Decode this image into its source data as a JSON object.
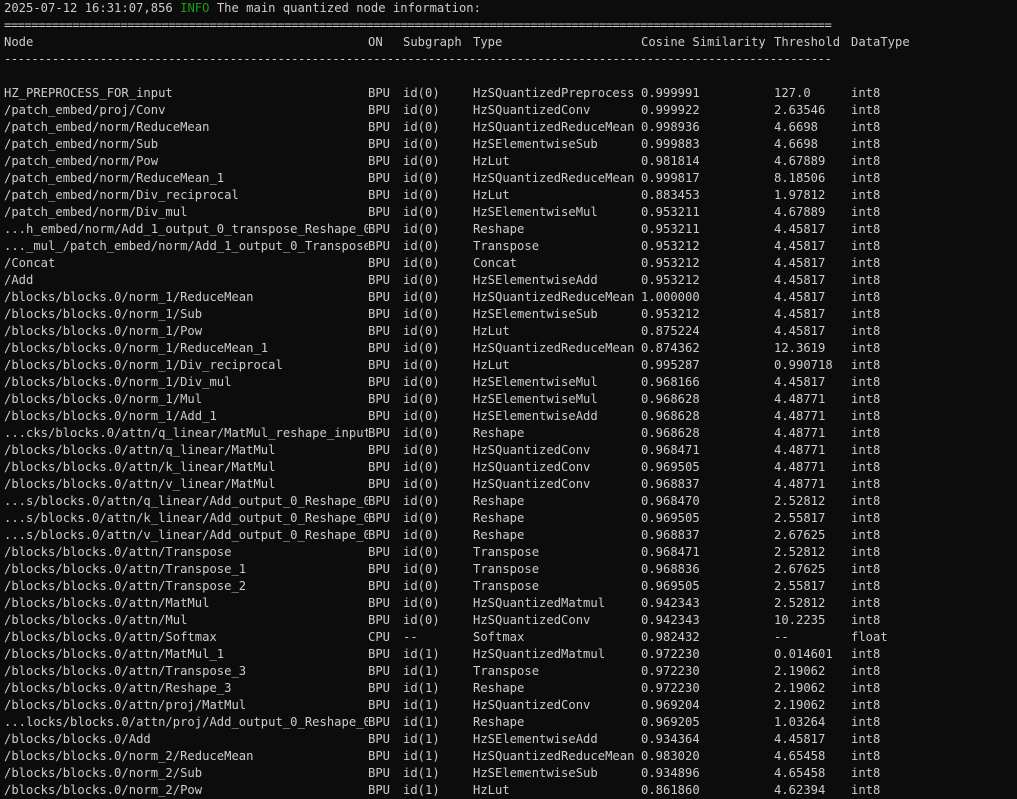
{
  "log": {
    "timestamp": "2025-07-12 16:31:07,856",
    "level": "INFO",
    "message": "The main quantized node information:"
  },
  "table": {
    "separator_double": "=========================================================================================================================",
    "separator_single": "-------------------------------------------------------------------------------------------------------------------------",
    "headers": {
      "node": "Node",
      "on": "ON",
      "subgraph": "Subgraph",
      "type": "Type",
      "cosine": "Cosine Similarity",
      "threshold": "Threshold",
      "datatype": "DataType"
    },
    "rows": [
      [
        "HZ_PREPROCESS_FOR_input",
        "BPU",
        "id(0)",
        "HzSQuantizedPreprocess",
        "0.999991",
        "127.0",
        "int8"
      ],
      [
        "/patch_embed/proj/Conv",
        "BPU",
        "id(0)",
        "HzSQuantizedConv",
        "0.999922",
        "2.63546",
        "int8"
      ],
      [
        "/patch_embed/norm/ReduceMean",
        "BPU",
        "id(0)",
        "HzSQuantizedReduceMean",
        "0.998936",
        "4.6698",
        "int8"
      ],
      [
        "/patch_embed/norm/Sub",
        "BPU",
        "id(0)",
        "HzSElementwiseSub",
        "0.999883",
        "4.6698",
        "int8"
      ],
      [
        "/patch_embed/norm/Pow",
        "BPU",
        "id(0)",
        "HzLut",
        "0.981814",
        "4.67889",
        "int8"
      ],
      [
        "/patch_embed/norm/ReduceMean_1",
        "BPU",
        "id(0)",
        "HzSQuantizedReduceMean",
        "0.999817",
        "8.18506",
        "int8"
      ],
      [
        "/patch_embed/norm/Div_reciprocal",
        "BPU",
        "id(0)",
        "HzLut",
        "0.883453",
        "1.97812",
        "int8"
      ],
      [
        "/patch_embed/norm/Div_mul",
        "BPU",
        "id(0)",
        "HzSElementwiseMul",
        "0.953211",
        "4.67889",
        "int8"
      ],
      [
        "...h_embed/norm/Add_1_output_0_transpose_Reshape_0",
        "BPU",
        "id(0)",
        "Reshape",
        "0.953211",
        "4.45817",
        "int8"
      ],
      [
        "..._mul_/patch_embed/norm/Add_1_output_0_Transpose",
        "BPU",
        "id(0)",
        "Transpose",
        "0.953212",
        "4.45817",
        "int8"
      ],
      [
        "/Concat",
        "BPU",
        "id(0)",
        "Concat",
        "0.953212",
        "4.45817",
        "int8"
      ],
      [
        "/Add",
        "BPU",
        "id(0)",
        "HzSElementwiseAdd",
        "0.953212",
        "4.45817",
        "int8"
      ],
      [
        "/blocks/blocks.0/norm_1/ReduceMean",
        "BPU",
        "id(0)",
        "HzSQuantizedReduceMean",
        "1.000000",
        "4.45817",
        "int8"
      ],
      [
        "/blocks/blocks.0/norm_1/Sub",
        "BPU",
        "id(0)",
        "HzSElementwiseSub",
        "0.953212",
        "4.45817",
        "int8"
      ],
      [
        "/blocks/blocks.0/norm_1/Pow",
        "BPU",
        "id(0)",
        "HzLut",
        "0.875224",
        "4.45817",
        "int8"
      ],
      [
        "/blocks/blocks.0/norm_1/ReduceMean_1",
        "BPU",
        "id(0)",
        "HzSQuantizedReduceMean",
        "0.874362",
        "12.3619",
        "int8"
      ],
      [
        "/blocks/blocks.0/norm_1/Div_reciprocal",
        "BPU",
        "id(0)",
        "HzLut",
        "0.995287",
        "0.990718",
        "int8"
      ],
      [
        "/blocks/blocks.0/norm_1/Div_mul",
        "BPU",
        "id(0)",
        "HzSElementwiseMul",
        "0.968166",
        "4.45817",
        "int8"
      ],
      [
        "/blocks/blocks.0/norm_1/Mul",
        "BPU",
        "id(0)",
        "HzSElementwiseMul",
        "0.968628",
        "4.48771",
        "int8"
      ],
      [
        "/blocks/blocks.0/norm_1/Add_1",
        "BPU",
        "id(0)",
        "HzSElementwiseAdd",
        "0.968628",
        "4.48771",
        "int8"
      ],
      [
        "...cks/blocks.0/attn/q_linear/MatMul_reshape_input",
        "BPU",
        "id(0)",
        "Reshape",
        "0.968628",
        "4.48771",
        "int8"
      ],
      [
        "/blocks/blocks.0/attn/q_linear/MatMul",
        "BPU",
        "id(0)",
        "HzSQuantizedConv",
        "0.968471",
        "4.48771",
        "int8"
      ],
      [
        "/blocks/blocks.0/attn/k_linear/MatMul",
        "BPU",
        "id(0)",
        "HzSQuantizedConv",
        "0.969505",
        "4.48771",
        "int8"
      ],
      [
        "/blocks/blocks.0/attn/v_linear/MatMul",
        "BPU",
        "id(0)",
        "HzSQuantizedConv",
        "0.968837",
        "4.48771",
        "int8"
      ],
      [
        "...s/blocks.0/attn/q_linear/Add_output_0_Reshape_0",
        "BPU",
        "id(0)",
        "Reshape",
        "0.968470",
        "2.52812",
        "int8"
      ],
      [
        "...s/blocks.0/attn/k_linear/Add_output_0_Reshape_0",
        "BPU",
        "id(0)",
        "Reshape",
        "0.969505",
        "2.55817",
        "int8"
      ],
      [
        "...s/blocks.0/attn/v_linear/Add_output_0_Reshape_0",
        "BPU",
        "id(0)",
        "Reshape",
        "0.968837",
        "2.67625",
        "int8"
      ],
      [
        "/blocks/blocks.0/attn/Transpose",
        "BPU",
        "id(0)",
        "Transpose",
        "0.968471",
        "2.52812",
        "int8"
      ],
      [
        "/blocks/blocks.0/attn/Transpose_1",
        "BPU",
        "id(0)",
        "Transpose",
        "0.968836",
        "2.67625",
        "int8"
      ],
      [
        "/blocks/blocks.0/attn/Transpose_2",
        "BPU",
        "id(0)",
        "Transpose",
        "0.969505",
        "2.55817",
        "int8"
      ],
      [
        "/blocks/blocks.0/attn/MatMul",
        "BPU",
        "id(0)",
        "HzSQuantizedMatmul",
        "0.942343",
        "2.52812",
        "int8"
      ],
      [
        "/blocks/blocks.0/attn/Mul",
        "BPU",
        "id(0)",
        "HzSQuantizedConv",
        "0.942343",
        "10.2235",
        "int8"
      ],
      [
        "/blocks/blocks.0/attn/Softmax",
        "CPU",
        "--",
        "Softmax",
        "0.982432",
        "--",
        "float"
      ],
      [
        "/blocks/blocks.0/attn/MatMul_1",
        "BPU",
        "id(1)",
        "HzSQuantizedMatmul",
        "0.972230",
        "0.014601",
        "int8"
      ],
      [
        "/blocks/blocks.0/attn/Transpose_3",
        "BPU",
        "id(1)",
        "Transpose",
        "0.972230",
        "2.19062",
        "int8"
      ],
      [
        "/blocks/blocks.0/attn/Reshape_3",
        "BPU",
        "id(1)",
        "Reshape",
        "0.972230",
        "2.19062",
        "int8"
      ],
      [
        "/blocks/blocks.0/attn/proj/MatMul",
        "BPU",
        "id(1)",
        "HzSQuantizedConv",
        "0.969204",
        "2.19062",
        "int8"
      ],
      [
        "...locks/blocks.0/attn/proj/Add_output_0_Reshape_0",
        "BPU",
        "id(1)",
        "Reshape",
        "0.969205",
        "1.03264",
        "int8"
      ],
      [
        "/blocks/blocks.0/Add",
        "BPU",
        "id(1)",
        "HzSElementwiseAdd",
        "0.934364",
        "4.45817",
        "int8"
      ],
      [
        "/blocks/blocks.0/norm_2/ReduceMean",
        "BPU",
        "id(1)",
        "HzSQuantizedReduceMean",
        "0.983020",
        "4.65458",
        "int8"
      ],
      [
        "/blocks/blocks.0/norm_2/Sub",
        "BPU",
        "id(1)",
        "HzSElementwiseSub",
        "0.934896",
        "4.65458",
        "int8"
      ],
      [
        "/blocks/blocks.0/norm_2/Pow",
        "BPU",
        "id(1)",
        "HzLut",
        "0.861860",
        "4.62394",
        "int8"
      ]
    ]
  }
}
